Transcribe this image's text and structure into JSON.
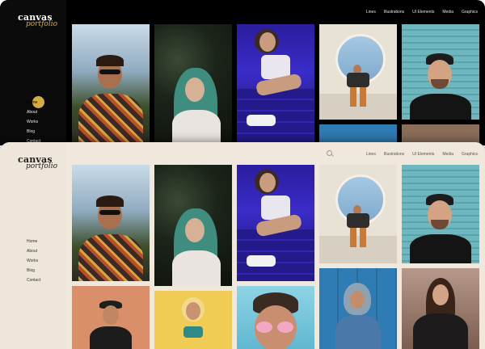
{
  "mockups": [
    {
      "theme": "dark",
      "logo": {
        "title": "canvas",
        "subtitle": "portfolio"
      },
      "top_nav": [
        "Lines",
        "Illustrations",
        "UI Elements",
        "Media",
        "Graphics"
      ],
      "side_nav": [
        "Home",
        "About",
        "Works",
        "Blog",
        "Contact"
      ],
      "active_item": "Home",
      "accent": "#d1ad44"
    },
    {
      "theme": "light",
      "logo": {
        "title": "canvas",
        "subtitle": "portfolio"
      },
      "top_nav": [
        "Lines",
        "Illustrations",
        "UI Elements",
        "Media",
        "Graphics"
      ],
      "side_nav": [
        "Home",
        "About",
        "Works",
        "Blog",
        "Contact"
      ],
      "search_icon": "search-icon"
    }
  ],
  "photos": [
    "man-sunglasses-palms-photo",
    "woman-green-hijab-photo",
    "woman-neon-stairs-photo",
    "man-sitting-arch-photo",
    "man-black-cap-photo",
    "man-hat-orange-wall-photo",
    "woman-yellow-background-photo",
    "man-pink-sunglasses-photo",
    "man-denim-hoodie-photo",
    "woman-leather-jacket-photo"
  ],
  "colors": {
    "dark_bg": "#000000",
    "light_bg": "#f0e7dd",
    "accent": "#d1ad44"
  }
}
